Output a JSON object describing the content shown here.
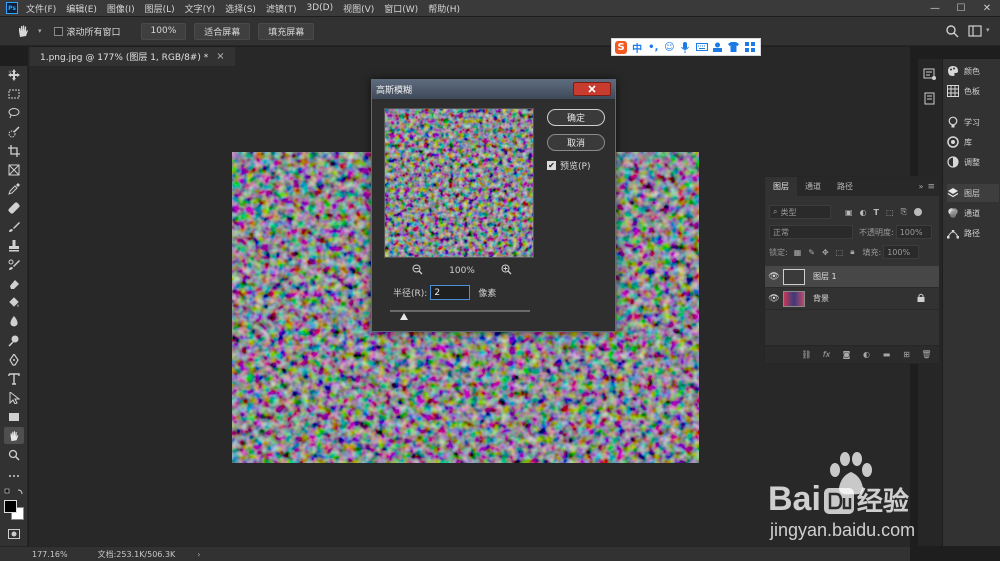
{
  "app": {
    "logo": "Ps"
  },
  "menu": [
    "文件(F)",
    "编辑(E)",
    "图像(I)",
    "图层(L)",
    "文字(Y)",
    "选择(S)",
    "滤镜(T)",
    "3D(D)",
    "视图(V)",
    "窗口(W)",
    "帮助(H)"
  ],
  "window_controls": {
    "minimize": "—",
    "maximize": "☐",
    "close": "✕"
  },
  "options": {
    "scroll_all_label": "滚动所有窗口",
    "zoom_label": "100%",
    "fit_screen_label": "适合屏幕",
    "fill_screen_label": "填充屏幕"
  },
  "tab": {
    "title": "1.png.jpg @ 177% (图层 1, RGB/8#) *",
    "close": "×"
  },
  "status": {
    "zoom": "177.16%",
    "doc": "文档:253.1K/506.3K"
  },
  "ime": {
    "brand": "S",
    "lang": "中"
  },
  "dock": [
    {
      "label": "颜色",
      "icon": "palette-icon"
    },
    {
      "label": "色板",
      "icon": "swatches-icon"
    },
    {
      "label": "学习",
      "icon": "lightbulb-icon"
    },
    {
      "label": "库",
      "icon": "libraries-icon"
    },
    {
      "label": "调整",
      "icon": "adjustments-icon"
    },
    {
      "label": "图层",
      "icon": "layers-icon"
    },
    {
      "label": "通道",
      "icon": "channels-icon"
    },
    {
      "label": "路径",
      "icon": "paths-icon"
    }
  ],
  "layers_panel": {
    "tabs": [
      "图层",
      "通道",
      "路径"
    ],
    "filter_label": "类型",
    "blend_mode": "正常",
    "opacity_label": "不透明度:",
    "opacity_value": "100%",
    "lock_label": "锁定:",
    "fill_label": "填充:",
    "fill_value": "100%",
    "layers": [
      {
        "name": "图层 1",
        "selected": true
      },
      {
        "name": "背景",
        "selected": false
      }
    ]
  },
  "dialog": {
    "title": "高斯模糊",
    "ok_label": "确定",
    "cancel_label": "取消",
    "preview_label": "预览(P)",
    "preview_checked": true,
    "zoom_value": "100%",
    "radius_label": "半径(R):",
    "radius_value": "2",
    "radius_unit": "像素",
    "slider_fraction": 0.1
  },
  "watermark": {
    "brand": "Bai",
    "brand_suffix": "经验",
    "url": "jingyan.baidu.com"
  }
}
